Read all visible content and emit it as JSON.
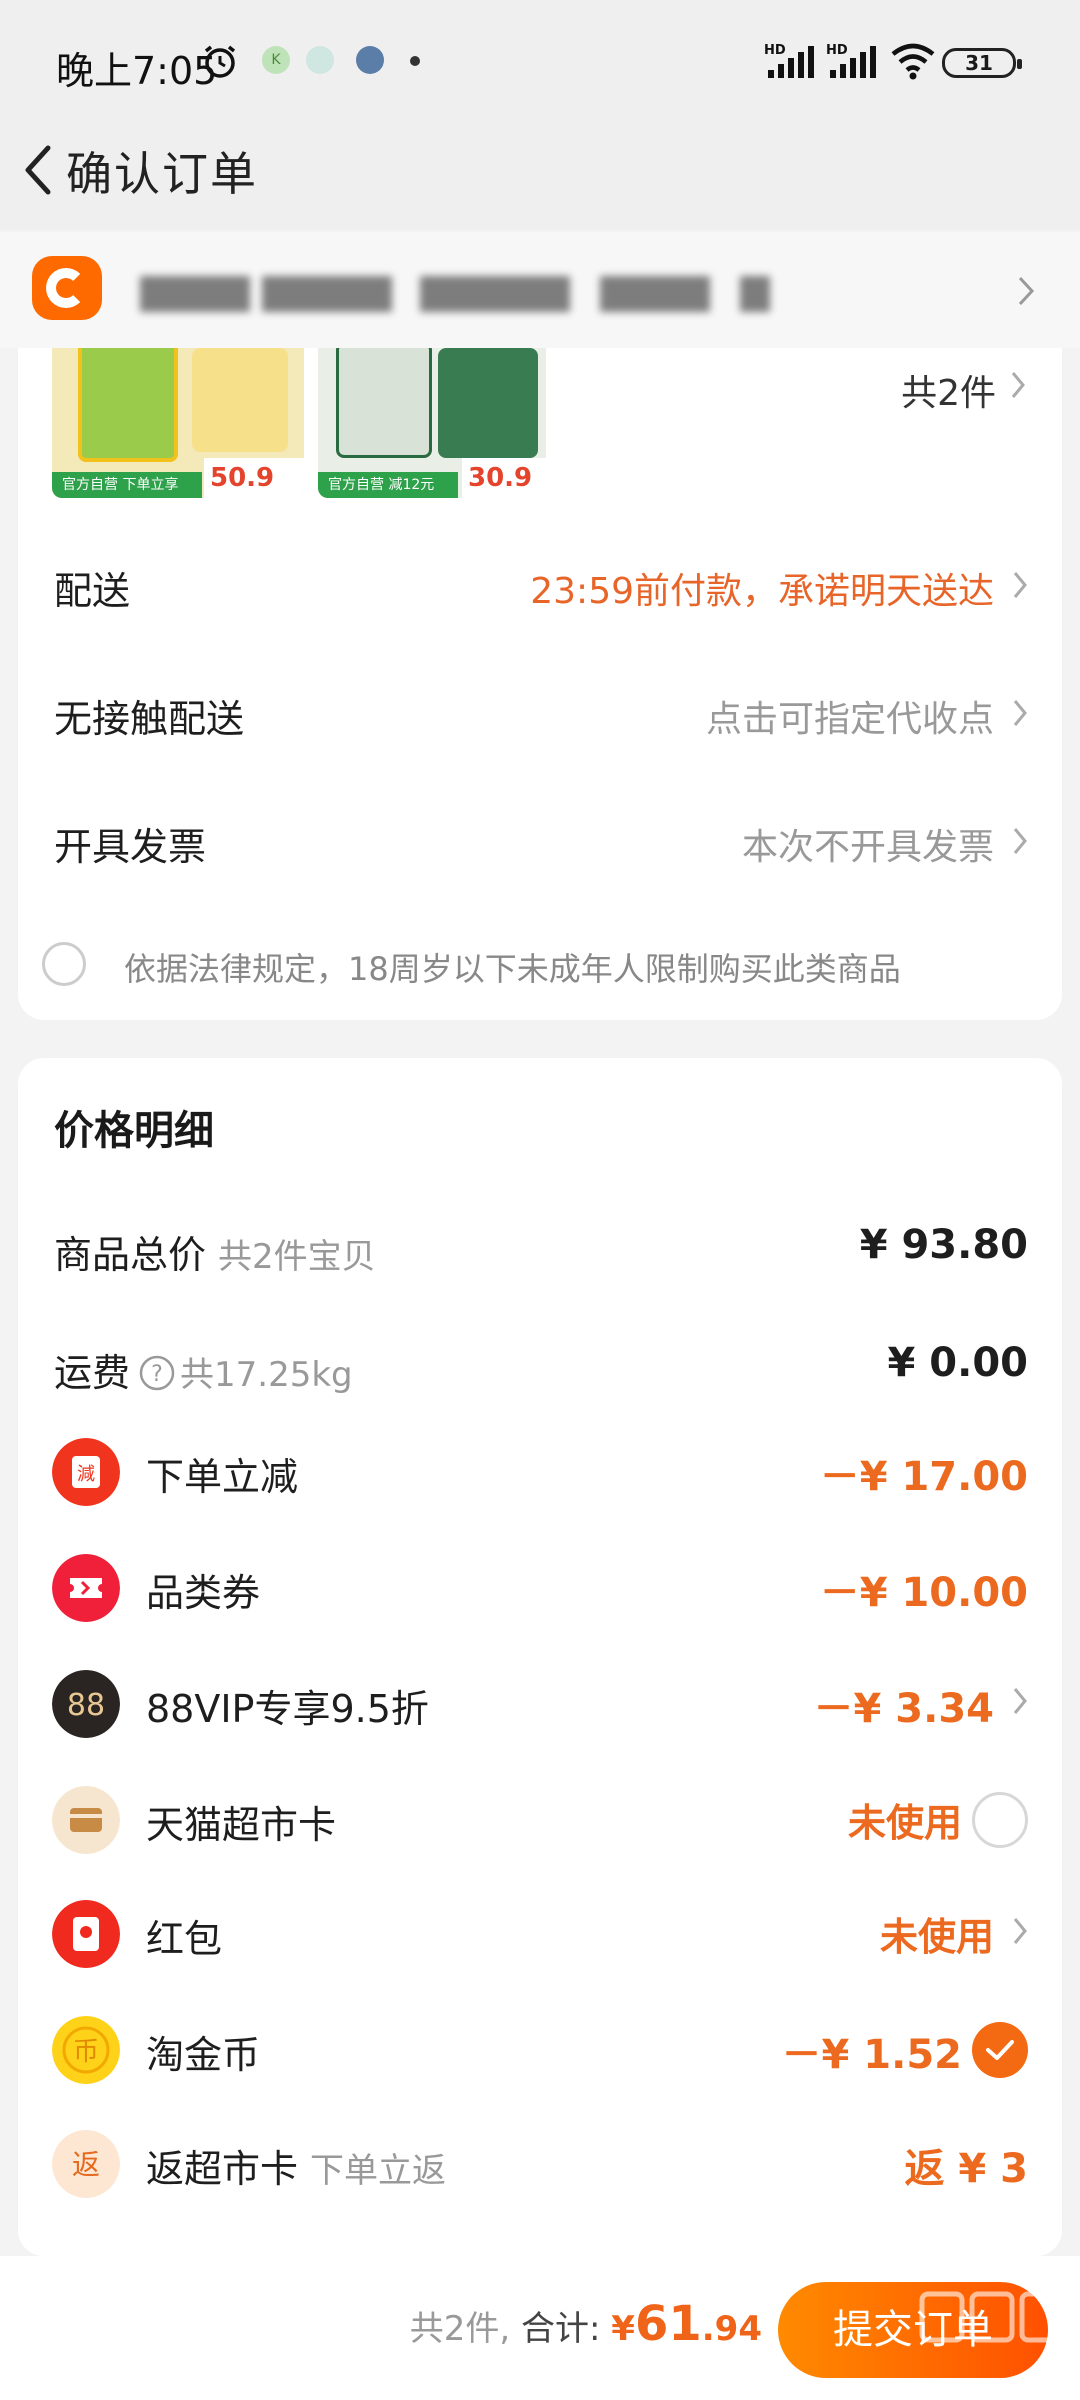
{
  "status_bar": {
    "time": "晚上7:05",
    "battery": "31",
    "network_1": "HD",
    "network_2": "HD"
  },
  "nav": {
    "title": "确认订单"
  },
  "order": {
    "item_count": "共2件",
    "products": [
      {
        "price": "50.9",
        "tag": "官方自营 下单立享"
      },
      {
        "price": "30.9",
        "tag": "官方自营 减12元"
      }
    ],
    "rows": [
      {
        "label": "配送",
        "value": "23:59前付款，承诺明天送达"
      },
      {
        "label": "无接触配送",
        "value": "点击可指定代收点"
      },
      {
        "label": "开具发票",
        "value": "本次不开具发票"
      }
    ],
    "age_notice": "依据法律规定，18周岁以下未成年人限制购买此类商品"
  },
  "price_detail": {
    "title": "价格明细",
    "goods_total": {
      "label": "商品总价",
      "sub": "共2件宝贝",
      "value": "¥ 93.80"
    },
    "shipping": {
      "label": "运费",
      "sub": "共17.25kg",
      "value": "¥ 0.00"
    },
    "discounts": [
      {
        "label": "下单立减",
        "value": "－¥ 17.00",
        "icon": "instant-discount-icon"
      },
      {
        "label": "品类券",
        "value": "－¥ 10.00",
        "icon": "coupon-icon"
      },
      {
        "label": "88VIP专享9.5折",
        "value": "－¥ 3.34",
        "icon": "88vip-icon"
      },
      {
        "label": "天猫超市卡",
        "value": "未使用",
        "icon": "card-icon"
      },
      {
        "label": "红包",
        "value": "未使用",
        "icon": "red-packet-icon"
      },
      {
        "label": "淘金币",
        "value": "－¥ 1.52",
        "icon": "gold-coin-icon"
      },
      {
        "label": "返超市卡",
        "sub": "下单立返",
        "value": "返 ¥ 3",
        "icon": "rebate-icon"
      }
    ]
  },
  "footer": {
    "count": "共2件,",
    "total_label": "合计:",
    "currency": "¥",
    "total_int": "61",
    "total_dec": ".94",
    "submit": "提交订单"
  },
  "colors": {
    "accent": "#ff5000",
    "price_orange": "#ec6a1f",
    "page_bg": "#f3f3f3"
  }
}
